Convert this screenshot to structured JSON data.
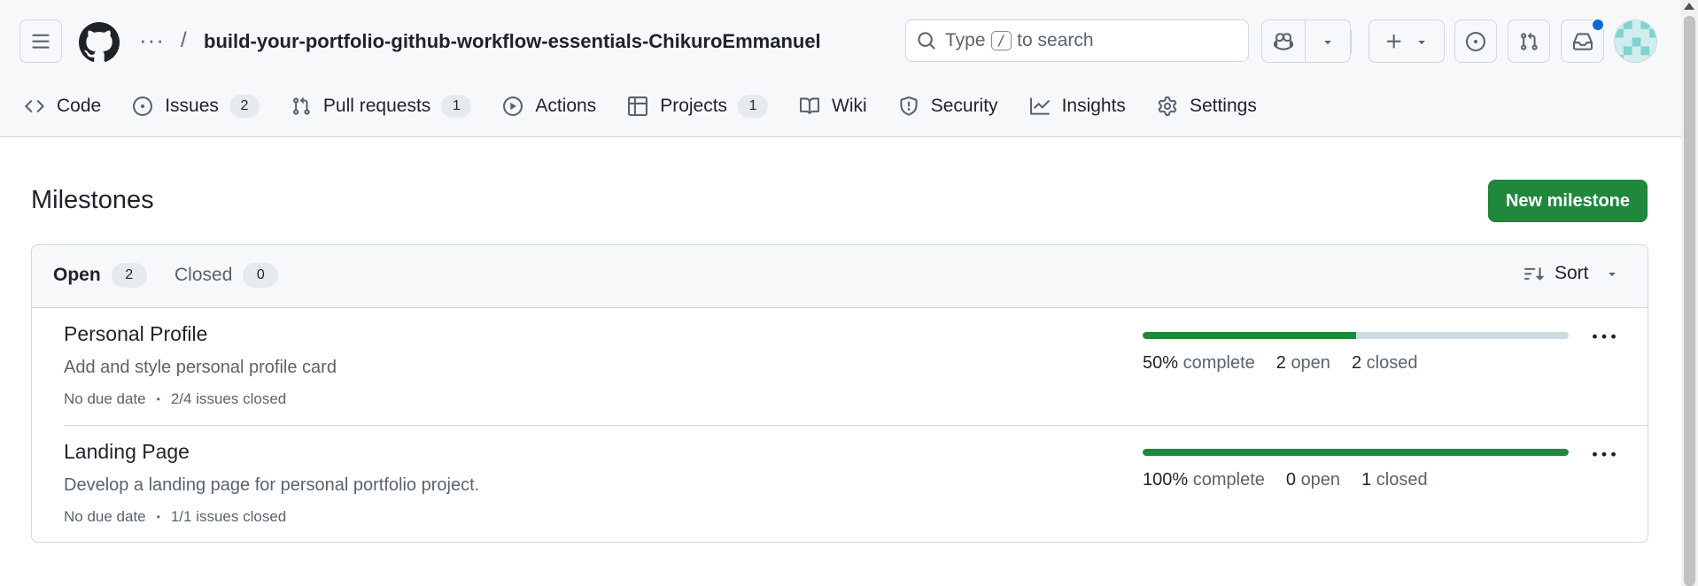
{
  "header": {
    "repo_name": "build-your-portfolio-github-workflow-essentials-ChikuroEmmanuel",
    "breadcrumb_more": "···",
    "breadcrumb_sep": "/",
    "search": {
      "prefix": "Type",
      "key": "/",
      "suffix": "to search"
    },
    "notification_color": "#0969da"
  },
  "tabs": [
    {
      "label": "Code",
      "icon": "code-icon"
    },
    {
      "label": "Issues",
      "icon": "issue-opened-icon",
      "count": "2"
    },
    {
      "label": "Pull requests",
      "icon": "git-pull-request-icon",
      "count": "1"
    },
    {
      "label": "Actions",
      "icon": "play-icon"
    },
    {
      "label": "Projects",
      "icon": "table-icon",
      "count": "1"
    },
    {
      "label": "Wiki",
      "icon": "book-icon"
    },
    {
      "label": "Security",
      "icon": "shield-icon"
    },
    {
      "label": "Insights",
      "icon": "graph-icon"
    },
    {
      "label": "Settings",
      "icon": "gear-icon"
    }
  ],
  "page": {
    "title": "Milestones",
    "new_button": "New milestone",
    "open_label": "Open",
    "open_count": "2",
    "closed_label": "Closed",
    "closed_count": "0",
    "sort_label": "Sort"
  },
  "milestones": [
    {
      "title": "Personal Profile",
      "description": "Add and style personal profile card",
      "due": "No due date",
      "issues": "2/4 issues closed",
      "progress": 0.5,
      "percent": "50%",
      "complete_label": "complete",
      "open": "2",
      "open_label": "open",
      "closed": "2",
      "closed_label": "closed"
    },
    {
      "title": "Landing Page",
      "description": "Develop a landing page for personal portfolio project.",
      "due": "No due date",
      "issues": "1/1 issues closed",
      "progress": 1.0,
      "percent": "100%",
      "complete_label": "complete",
      "open": "0",
      "open_label": "open",
      "closed": "1",
      "closed_label": "closed"
    }
  ],
  "colors": {
    "accent_green": "#1f883d",
    "progress_track": "#d1d9e0",
    "muted_text": "#59636e"
  }
}
